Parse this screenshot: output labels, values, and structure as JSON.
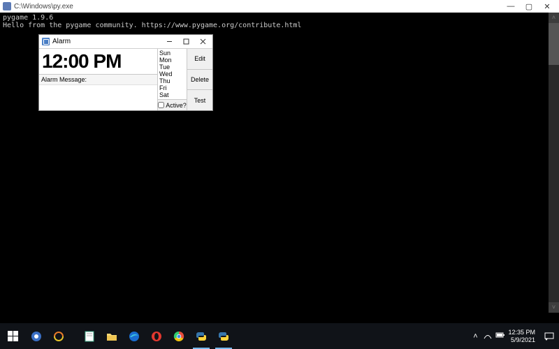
{
  "console": {
    "title": "C:\\Windows\\py.exe",
    "line1": "pygame 1.9.6",
    "line2": "Hello from the pygame community. https://www.pygame.org/contribute.html"
  },
  "alarm": {
    "title": "Alarm",
    "time": "12:00 PM",
    "msg_label": "Alarm Message:",
    "days": [
      "Sun",
      "Mon",
      "Tue",
      "Wed",
      "Thu",
      "Fri",
      "Sat"
    ],
    "active_label": "Active?",
    "buttons": {
      "edit": "Edit",
      "delete": "Delete",
      "test": "Test"
    }
  },
  "taskbar": {
    "clock_time": "12:35 PM",
    "clock_date": "5/9/2021"
  }
}
